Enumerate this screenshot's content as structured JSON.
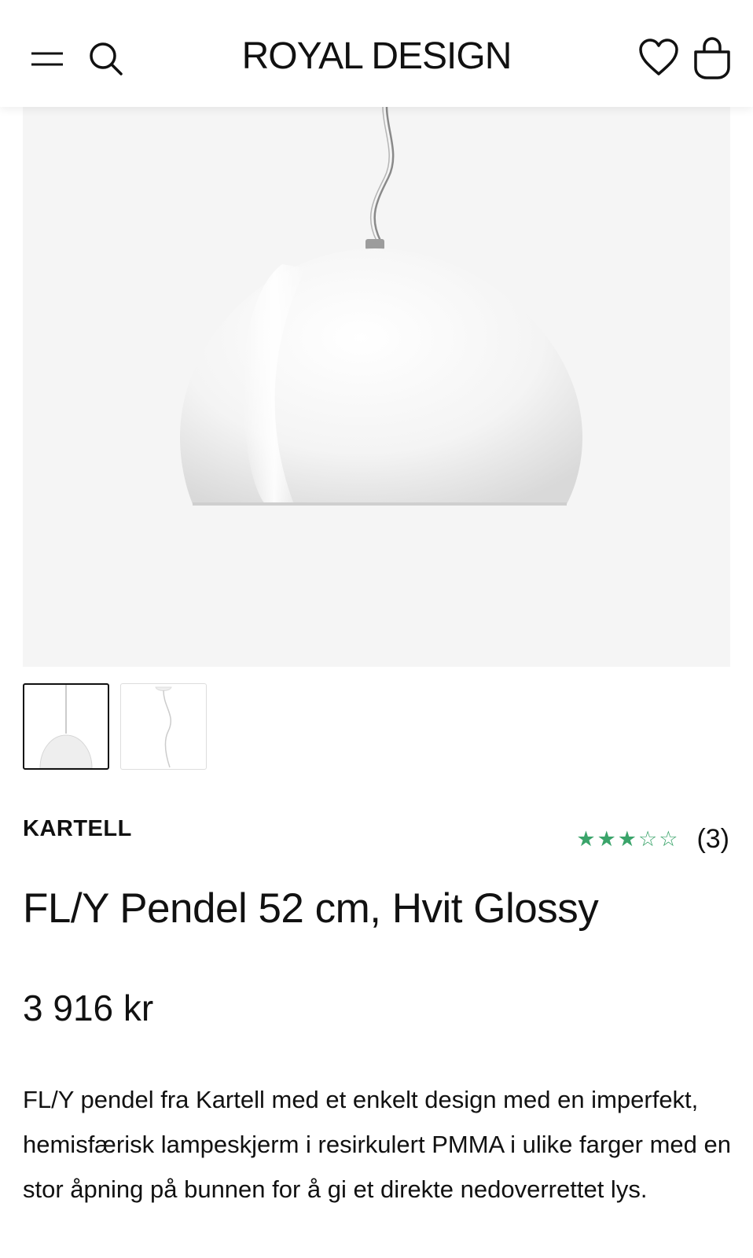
{
  "header": {
    "logo": "ROYAL DESIGN",
    "icons": [
      "menu-icon",
      "search-icon",
      "heart-icon",
      "shopping-bag-icon"
    ]
  },
  "gallery": {
    "main_image": "white-pendant-lamp-image",
    "thumbnails": [
      "pendant-lamp-thumbnail",
      "pendant-lamp-cable-thumbnail"
    ],
    "selected_thumbnail": 0
  },
  "product": {
    "brand": "KARTELL",
    "rating": {
      "value": 3,
      "max": 5,
      "count_label": "(3)"
    },
    "title": "FL/Y Pendel 52 cm, Hvit Glossy",
    "price": "3 916 kr",
    "description": "FL/Y pendel fra Kartell med et enkelt design med en imperfekt, hemisfærisk lampeskjerm i resirkulert PMMA i ulike farger med en stor åpning på bunnen for å gi et direkte nedoverrettet lys."
  },
  "colors": {
    "star": "#3aa46a",
    "text": "#111111",
    "image_background": "#f5f5f5"
  }
}
